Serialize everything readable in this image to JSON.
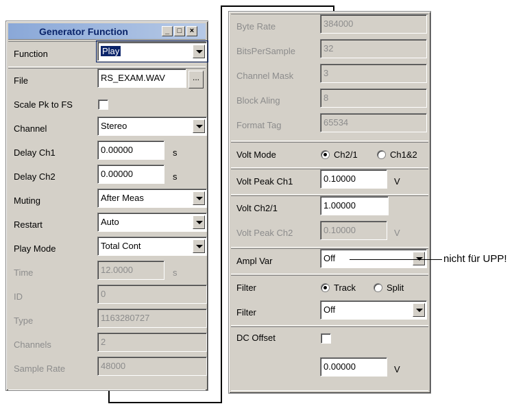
{
  "window": {
    "title": "Generator Function",
    "minimize_glyph": "_",
    "maximize_glyph": "□",
    "close_glyph": "×"
  },
  "left": {
    "function": {
      "label": "Function",
      "value": "Play"
    },
    "file": {
      "label": "File",
      "value": "RS_EXAM.WAV",
      "browse": "..."
    },
    "scale": {
      "label": "Scale Pk to FS",
      "checked": false
    },
    "channel": {
      "label": "Channel",
      "value": "Stereo"
    },
    "delay_ch1": {
      "label": "Delay Ch1",
      "value": "0.00000",
      "unit": "s"
    },
    "delay_ch2": {
      "label": "Delay Ch2",
      "value": "0.00000",
      "unit": "s"
    },
    "muting": {
      "label": "Muting",
      "value": "After Meas"
    },
    "restart": {
      "label": "Restart",
      "value": "Auto"
    },
    "play_mode": {
      "label": "Play Mode",
      "value": "Total Cont"
    },
    "time": {
      "label": "Time",
      "value": "12.0000",
      "unit": "s"
    },
    "id": {
      "label": "ID",
      "value": "0"
    },
    "type": {
      "label": "Type",
      "value": "1163280727"
    },
    "channels": {
      "label": "Channels",
      "value": "2"
    },
    "sample_rate": {
      "label": "Sample Rate",
      "value": "48000"
    }
  },
  "right": {
    "byte_rate": {
      "label": "Byte Rate",
      "value": "384000"
    },
    "bits_per_sample": {
      "label": "BitsPerSample",
      "value": "32"
    },
    "channel_mask": {
      "label": "Channel Mask",
      "value": "3"
    },
    "block_aling": {
      "label": "Block Aling",
      "value": "8"
    },
    "format_tag": {
      "label": "Format Tag",
      "value": "65534"
    },
    "volt_mode": {
      "label": "Volt Mode",
      "options": [
        "Ch2/1",
        "Ch1&2"
      ],
      "selected": "Ch2/1"
    },
    "volt_peak_ch1": {
      "label": "Volt Peak Ch1",
      "value": "0.10000",
      "unit": "V"
    },
    "volt_ch2_1": {
      "label": "Volt Ch2/1",
      "value": "1.00000"
    },
    "volt_peak_ch2": {
      "label": "Volt Peak Ch2",
      "value": "0.10000",
      "unit": "V"
    },
    "ampl_var": {
      "label": "Ampl Var",
      "value": "Off"
    },
    "filter_mode": {
      "label": "Filter",
      "options": [
        "Track",
        "Split"
      ],
      "selected": "Track"
    },
    "filter": {
      "label": "Filter",
      "value": "Off"
    },
    "dc_offset": {
      "label": "DC Offset",
      "checked": false,
      "value": "0.00000",
      "unit": "V"
    }
  },
  "annotation": "nicht für UPP!"
}
